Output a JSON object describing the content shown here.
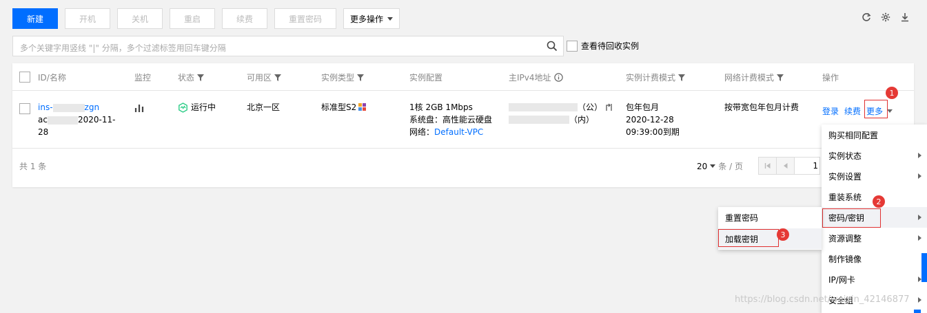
{
  "toolbar": {
    "new_label": "新建",
    "start_label": "开机",
    "stop_label": "关机",
    "restart_label": "重启",
    "renew_label": "续费",
    "reset_pwd_label": "重置密码",
    "more_ops_label": "更多操作"
  },
  "search": {
    "placeholder": "多个关键字用竖线 \"|\" 分隔，多个过滤标签用回车键分隔",
    "recycle_label": "查看待回收实例"
  },
  "table": {
    "headers": {
      "id_name": "ID/名称",
      "monitor": "监控",
      "status": "状态",
      "zone": "可用区",
      "instance_type": "实例类型",
      "config": "实例配置",
      "ipv4": "主IPv4地址",
      "billing": "实例计费模式",
      "network_billing": "网络计费模式",
      "actions": "操作"
    },
    "row": {
      "id_prefix": "ins-",
      "id_suffix": "zgn",
      "name_prefix": "ac",
      "name_suffix": "2020-11-",
      "name_line3": "28",
      "status": "运行中",
      "zone": "北京一区",
      "instance_type": "标准型S2",
      "config_line1": "1核 2GB 1Mbps",
      "config_line2": "系统盘：高性能云硬盘",
      "config_line3_label": "网络：",
      "config_line3_link": "Default-VPC",
      "ip_public_suffix": "（公）",
      "ip_private_suffix": "（内）",
      "billing_line1": "包年包月",
      "billing_line2": "2020-12-28",
      "billing_line3": "09:39:00到期",
      "network_billing": "按带宽包年包月计费",
      "action_login": "登录",
      "action_renew": "续费",
      "action_more": "更多"
    }
  },
  "footer": {
    "total": "共 1 条",
    "per_page": "20",
    "per_page_unit": "条 / 页",
    "page": "1"
  },
  "more_menu": {
    "items": [
      {
        "label": "购买相同配置",
        "submenu": false
      },
      {
        "label": "实例状态",
        "submenu": true
      },
      {
        "label": "实例设置",
        "submenu": true
      },
      {
        "label": "重装系统",
        "submenu": false
      },
      {
        "label": "密码/密钥",
        "submenu": true
      },
      {
        "label": "资源调整",
        "submenu": true
      },
      {
        "label": "制作镜像",
        "submenu": false
      },
      {
        "label": "IP/网卡",
        "submenu": true
      },
      {
        "label": "安全组",
        "submenu": true
      }
    ]
  },
  "sub_menu": {
    "items": [
      {
        "label": "重置密码"
      },
      {
        "label": "加载密钥"
      }
    ]
  },
  "badges": [
    "1",
    "2",
    "3"
  ],
  "watermark": "https://blog.csdn.net/weixin_42146877",
  "colors": {
    "primary": "#006eff",
    "highlight": "#e53935",
    "running": "#29cc85"
  }
}
